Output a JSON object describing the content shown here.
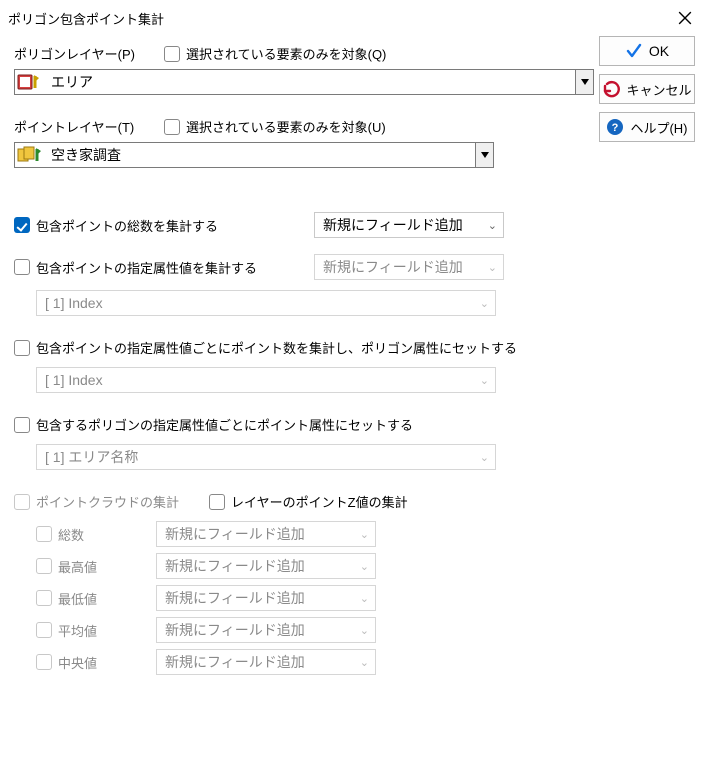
{
  "title": "ポリゴン包含ポイント集計",
  "buttons": {
    "ok": "OK",
    "cancel": "キャンセル",
    "help": "ヘルプ(H)"
  },
  "polygonLayer": {
    "label": "ポリゴンレイヤー(P)",
    "selectedOnlyLabel": "選択されている要素のみを対象(Q)",
    "value": "エリア"
  },
  "pointLayer": {
    "label": "ポイントレイヤー(T)",
    "selectedOnlyLabel": "選択されている要素のみを対象(U)",
    "value": "空き家調査"
  },
  "options": {
    "countTotal": {
      "label": "包含ポイントの総数を集計する",
      "fieldSelect": "新規にフィールド追加"
    },
    "attrValue": {
      "label": "包含ポイントの指定属性値を集計する",
      "fieldSelect": "新規にフィールド追加",
      "attrSelect": "[ 1] Index"
    },
    "countByAttr": {
      "label": "包含ポイントの指定属性値ごとにポイント数を集計し、ポリゴン属性にセットする",
      "attrSelect": "[ 1] Index"
    },
    "polyAttrToPoint": {
      "label": "包含するポリゴンの指定属性値ごとにポイント属性にセットする",
      "attrSelect": "[ 1] エリア名称"
    }
  },
  "pointcloud": {
    "label": "ポイントクラウドの集計",
    "layerZ": "レイヤーのポイントZ値の集計",
    "rows": {
      "total": {
        "label": "総数",
        "select": "新規にフィールド追加"
      },
      "max": {
        "label": "最高値",
        "select": "新規にフィールド追加"
      },
      "min": {
        "label": "最低値",
        "select": "新規にフィールド追加"
      },
      "avg": {
        "label": "平均値",
        "select": "新規にフィールド追加"
      },
      "median": {
        "label": "中央値",
        "select": "新規にフィールド追加"
      }
    }
  }
}
